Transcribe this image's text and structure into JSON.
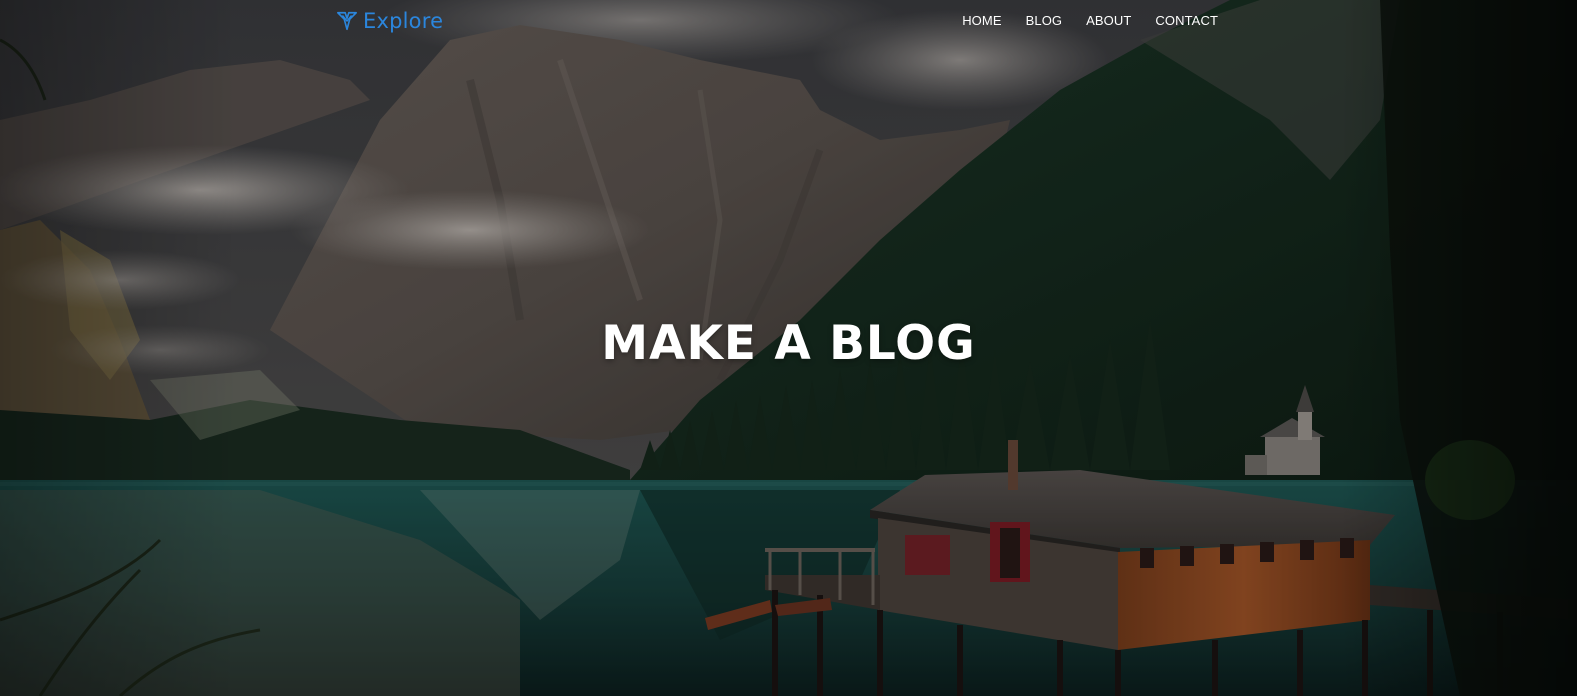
{
  "brand": {
    "name": "Explore",
    "color": "#2b86dd"
  },
  "nav": {
    "items": [
      {
        "label": "HOME"
      },
      {
        "label": "BLOG"
      },
      {
        "label": "ABOUT"
      },
      {
        "label": "CONTACT"
      }
    ]
  },
  "hero": {
    "title": "MAKE A BLOG",
    "background": "mountain-lake-boathouse-photo"
  }
}
